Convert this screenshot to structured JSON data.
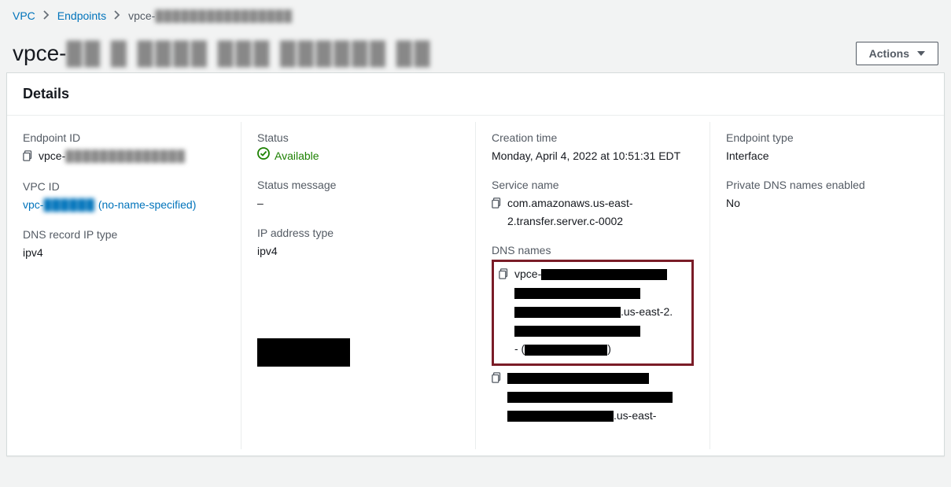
{
  "breadcrumb": {
    "vpc": "VPC",
    "endpoints": "Endpoints",
    "current_prefix": "vpce-"
  },
  "page_title_prefix": "vpce-",
  "actions_label": "Actions",
  "panel": {
    "title": "Details",
    "col1": {
      "endpoint_id_label": "Endpoint ID",
      "endpoint_id_prefix": "vpce-",
      "vpc_id_label": "VPC ID",
      "vpc_id_prefix": "vpc-",
      "vpc_id_suffix": " (no-name-specified)",
      "dns_record_ip_type_label": "DNS record IP type",
      "dns_record_ip_type_value": "ipv4"
    },
    "col2": {
      "status_label": "Status",
      "status_value": "Available",
      "status_message_label": "Status message",
      "status_message_value": "–",
      "ip_address_type_label": "IP address type",
      "ip_address_type_value": "ipv4"
    },
    "col3": {
      "creation_time_label": "Creation time",
      "creation_time_value": "Monday, April 4, 2022 at 10:51:31 EDT",
      "service_name_label": "Service name",
      "service_name_value": "com.amazonaws.us-east-2.transfer.server.c-0002",
      "dns_names_label": "DNS names",
      "dns1_prefix": "vpce-",
      "dns1_region": ".us-east-2.",
      "dns1_dash": "- (",
      "dns1_close": ")",
      "dns2_region": ".us-east-"
    },
    "col4": {
      "endpoint_type_label": "Endpoint type",
      "endpoint_type_value": "Interface",
      "private_dns_label": "Private DNS names enabled",
      "private_dns_value": "No"
    }
  }
}
